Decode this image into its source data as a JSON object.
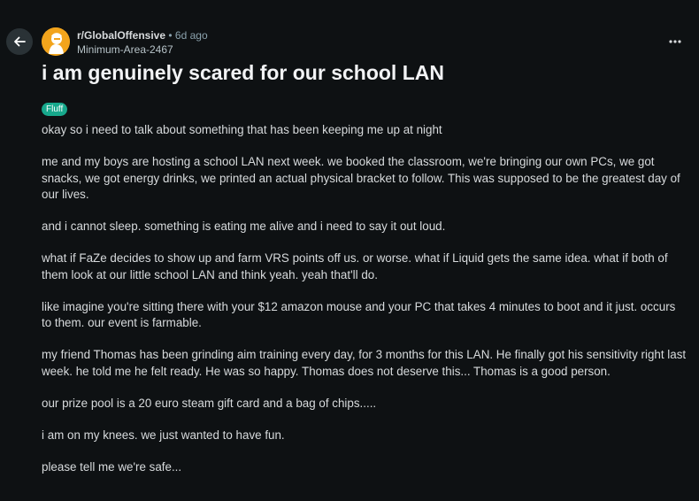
{
  "post": {
    "subreddit": "r/GlobalOffensive",
    "separator": "•",
    "age": "6d ago",
    "author": "Minimum-Area-2467",
    "title": "i am genuinely scared for our school LAN",
    "flair": "Fluff",
    "paragraphs": [
      "okay so i need to talk about something that has been keeping me up at night",
      "me and my boys are hosting a school LAN next week. we booked the classroom, we're bringing our own PCs, we got snacks, we got energy drinks, we printed an actual physical bracket to follow. This was supposed to be the greatest day of our lives.",
      "and i cannot sleep. something is eating me alive and i need to say it out loud.",
      "what if FaZe decides to show up and farm VRS points off us. or worse. what if Liquid gets the same idea. what if both of them look at our little school LAN and think yeah. yeah that'll do.",
      "like imagine you're sitting there with your $12 amazon mouse and your PC that takes 4 minutes to boot and it just. occurs to them. our event is farmable.",
      "my friend Thomas has been grinding aim training every day, for 3 months for this LAN. He finally got his sensitivity right last week. he told me he felt ready. He was so happy. Thomas does not deserve this... Thomas is a good person.",
      "our prize pool is a 20 euro steam gift card and a bag of chips.....",
      "i am on my knees. we just wanted to have fun.",
      "please tell me we're safe..."
    ]
  },
  "icons": {
    "back": "arrow-left-icon",
    "more": "ellipsis-horizontal-icon",
    "avatar": "subreddit-avatar"
  },
  "colors": {
    "background": "#0e1113",
    "flair": "#17a88c",
    "avatar": "#f2a41c",
    "back_button": "#2a3236"
  }
}
